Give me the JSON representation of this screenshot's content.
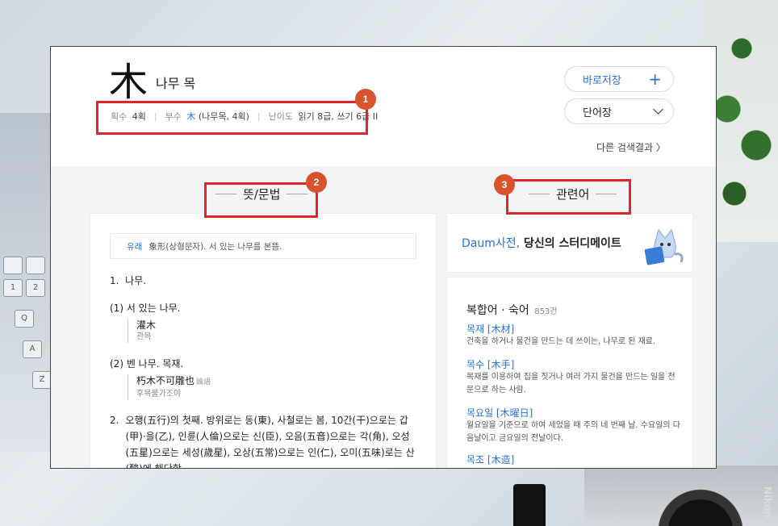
{
  "entry": {
    "hanja": "木",
    "meaning": "나무 목",
    "meta": {
      "strokes_label": "획수",
      "strokes_value": "4획",
      "radical_label": "부수",
      "radical_char": "木",
      "radical_value": "(나무목, 4획)",
      "level_label": "난이도",
      "level_value": "읽기 8급, 쓰기 6급 II"
    }
  },
  "actions": {
    "save_label": "바로저장",
    "save_icon": "+",
    "vocab_label": "단어장",
    "other_results": "다른 검색결과 〉"
  },
  "sections": {
    "meaning_title": "뜻/문법",
    "related_title": "관련어"
  },
  "definitions": {
    "etym_label": "유래",
    "etym_text": "象形(상형문자). 서 있는 나무를 본뜸.",
    "def1_num": "1.",
    "def1_text": "나무.",
    "sub1_num": "(1)",
    "sub1_text": "서 있는 나무.",
    "sub1_ex_hanja": "灌木",
    "sub1_ex_read": "관목",
    "sub2_num": "(2)",
    "sub2_text": "벤 나무. 목재.",
    "sub2_ex_hanja": "朽木不可雕也",
    "sub2_ex_src": "論語",
    "sub2_ex_read": "후목불가조야",
    "def2_num": "2.",
    "def2_text": "오행(五行)의 첫째. 방위로는 동(東), 사철로는 봄, 10간(干)으로는 갑(甲)·을(乙), 인륜(人倫)으로는 신(臣), 오음(五音)으로는 각(角), 오성(五星)으로는 세성(歲星), 오상(五常)으로는 인(仁), 오미(五味)로는 산(酸)에 해당함."
  },
  "promo": {
    "brand": "Daum사전,",
    "text": " 당신의 스터디메이트"
  },
  "compound": {
    "title": "복합어 · 숙어",
    "count": "853건",
    "words": [
      {
        "word": "목재 [木材]",
        "desc": "건축을 하거나 물건을 만드는 데 쓰이는, 나무로 된 재료."
      },
      {
        "word": "목수 [木手]",
        "desc": "목재를 이용하여 집을 짓거나 여러 가지 물건을 만드는 일을 전문으로 하는 사람."
      },
      {
        "word": "목요일 [木曜日]",
        "desc": "월요일을 기준으로 하여 세었을 때 주의 네 번째 날. 수요일의 다음날이고 금요일의 전날이다."
      },
      {
        "word": "목조 [木造]",
        "desc": ""
      }
    ]
  },
  "annotations": {
    "badge1": "1",
    "badge2": "2",
    "badge3": "3",
    "color": "#e0242c"
  },
  "background": {
    "keys": [
      "1",
      "2",
      "Q",
      "A",
      "Z"
    ],
    "camera_brand": "Nikon"
  }
}
